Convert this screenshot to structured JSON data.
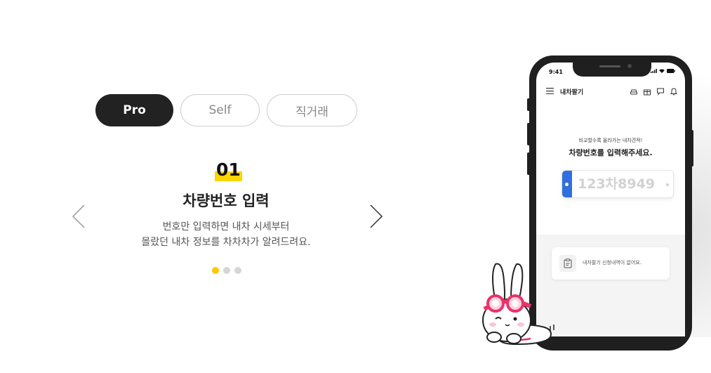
{
  "tabs": [
    {
      "label": "Pro",
      "active": true
    },
    {
      "label": "Self",
      "active": false
    },
    {
      "label": "직거래",
      "active": false
    }
  ],
  "slide": {
    "number": "01",
    "title": "차량번호 입력",
    "description_line1": "번호만 입력하면 내차 시세부터",
    "description_line2": "몰랐던 내차 정보를 차차차가 알려드려요.",
    "total_slides": 3,
    "current_index": 1
  },
  "colors": {
    "accent": "#ffc800",
    "dark": "#222222",
    "plate_blue": "#2f6fe0"
  },
  "phone": {
    "status_time": "9:41",
    "app_title": "내차팔기",
    "header_icons": [
      "car-wash-icon",
      "gift-icon",
      "chat-icon",
      "bell-icon"
    ],
    "sub_text": "비교할수록 올라가는 내차견적!",
    "prompt": "차량번호를 입력해주세요.",
    "plate_placeholder": "123차8949",
    "empty_message": "내차팔기 신청내역이 없어요."
  }
}
